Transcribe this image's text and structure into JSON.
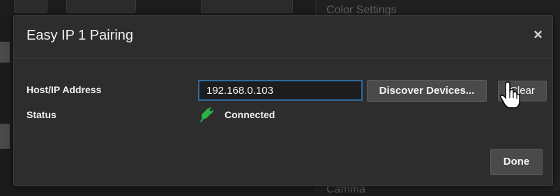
{
  "background": {
    "heading_top": "Color Settings",
    "heading_bottom": "Camma"
  },
  "modal": {
    "title": "Easy IP 1 Pairing",
    "close_label": "×",
    "host_label": "Host/IP Address",
    "host_value": "192.168.0.103",
    "status_label": "Status",
    "status_value": "Connected",
    "discover_label": "Discover Devices...",
    "clear_label": "Clear",
    "done_label": "Done",
    "status_icon": "plug-connected-icon",
    "accent_color": "#2f6aa0",
    "status_color": "#2fb34a"
  }
}
